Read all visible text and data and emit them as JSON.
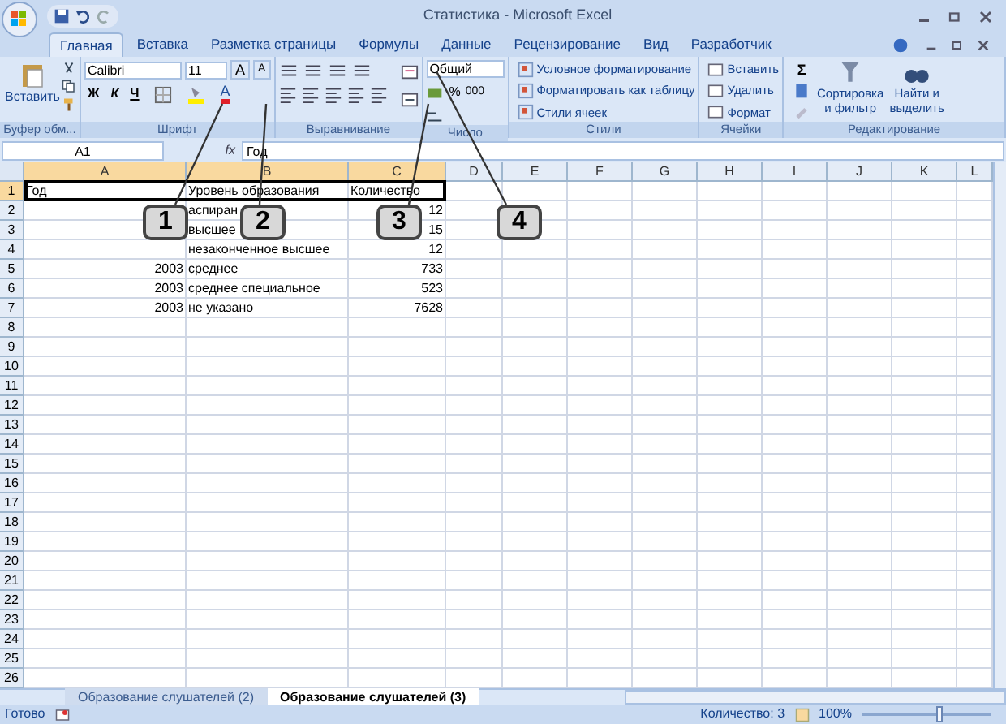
{
  "window": {
    "title": "Статистика - Microsoft Excel"
  },
  "tabs": [
    {
      "label": "Главная",
      "selected": true
    },
    {
      "label": "Вставка",
      "selected": false
    },
    {
      "label": "Разметка страницы",
      "selected": false
    },
    {
      "label": "Формулы",
      "selected": false
    },
    {
      "label": "Данные",
      "selected": false
    },
    {
      "label": "Рецензирование",
      "selected": false
    },
    {
      "label": "Вид",
      "selected": false
    },
    {
      "label": "Разработчик",
      "selected": false
    }
  ],
  "ribbon": {
    "clipboard": {
      "title": "Буфер обм...",
      "paste": "Вставить"
    },
    "font": {
      "title": "Шрифт",
      "name": "Calibri",
      "size": "11",
      "bold": "Ж",
      "italic": "К",
      "underline": "Ч",
      "grow": "A",
      "shrink": "A",
      "font_color": "A"
    },
    "alignment": {
      "title": "Выравнивание"
    },
    "number": {
      "title": "Число",
      "format": "Общий",
      "percent": "%",
      "thousands": "000"
    },
    "styles": {
      "title": "Стили",
      "items": [
        "Условное форматирование",
        "Форматировать как таблицу",
        "Стили ячеек"
      ]
    },
    "cells": {
      "title": "Ячейки",
      "items": [
        "Вставить",
        "Удалить",
        "Формат"
      ]
    },
    "editing": {
      "title": "Редактирование",
      "sum": "Σ",
      "sort": "Сортировка и фильтр",
      "find": "Найти и выделить"
    }
  },
  "formula_bar": {
    "name_box": "A1",
    "fx": "fx",
    "value": "Год"
  },
  "columns": [
    {
      "label": "A",
      "selected": true
    },
    {
      "label": "B",
      "selected": true
    },
    {
      "label": "C",
      "selected": true
    },
    {
      "label": "D",
      "selected": false
    },
    {
      "label": "E",
      "selected": false
    },
    {
      "label": "F",
      "selected": false
    },
    {
      "label": "G",
      "selected": false
    },
    {
      "label": "H",
      "selected": false
    },
    {
      "label": "I",
      "selected": false
    },
    {
      "label": "J",
      "selected": false
    },
    {
      "label": "K",
      "selected": false
    },
    {
      "label": "L",
      "selected": false
    }
  ],
  "rows": [
    {
      "label": "1",
      "selected": true,
      "cells": [
        "Год",
        "Уровень образования",
        "Количество"
      ]
    },
    {
      "label": "2",
      "selected": false,
      "cells": [
        "",
        "аспиран",
        "12"
      ]
    },
    {
      "label": "3",
      "selected": false,
      "cells": [
        "",
        "высшее",
        "15"
      ]
    },
    {
      "label": "4",
      "selected": false,
      "cells": [
        "",
        "незаконченное высшее",
        "12"
      ]
    },
    {
      "label": "5",
      "selected": false,
      "cells": [
        "2003",
        "среднее",
        "733"
      ]
    },
    {
      "label": "6",
      "selected": false,
      "cells": [
        "2003",
        "среднее специальное",
        "523"
      ]
    },
    {
      "label": "7",
      "selected": false,
      "cells": [
        "2003",
        "не указано",
        "7628"
      ]
    },
    {
      "label": "8",
      "selected": false,
      "cells": []
    },
    {
      "label": "9",
      "selected": false,
      "cells": []
    },
    {
      "label": "10",
      "selected": false,
      "cells": []
    },
    {
      "label": "11",
      "selected": false,
      "cells": []
    },
    {
      "label": "12",
      "selected": false,
      "cells": []
    },
    {
      "label": "13",
      "selected": false,
      "cells": []
    },
    {
      "label": "14",
      "selected": false,
      "cells": []
    },
    {
      "label": "15",
      "selected": false,
      "cells": []
    },
    {
      "label": "16",
      "selected": false,
      "cells": []
    },
    {
      "label": "17",
      "selected": false,
      "cells": []
    },
    {
      "label": "18",
      "selected": false,
      "cells": []
    },
    {
      "label": "19",
      "selected": false,
      "cells": []
    },
    {
      "label": "20",
      "selected": false,
      "cells": []
    },
    {
      "label": "21",
      "selected": false,
      "cells": []
    },
    {
      "label": "22",
      "selected": false,
      "cells": []
    },
    {
      "label": "23",
      "selected": false,
      "cells": []
    },
    {
      "label": "24",
      "selected": false,
      "cells": []
    },
    {
      "label": "25",
      "selected": false,
      "cells": []
    },
    {
      "label": "26",
      "selected": false,
      "cells": []
    }
  ],
  "callouts": [
    "1",
    "2",
    "3",
    "4"
  ],
  "sheet_tabs": [
    {
      "label": "Образование слушателей (2)",
      "selected": false
    },
    {
      "label": "Образование слушателей (3)",
      "selected": true
    }
  ],
  "status_bar": {
    "state": "Готово",
    "count": "Количество: 3",
    "zoom": "100%",
    "zoom_slider": {
      "level": 0.6
    }
  }
}
